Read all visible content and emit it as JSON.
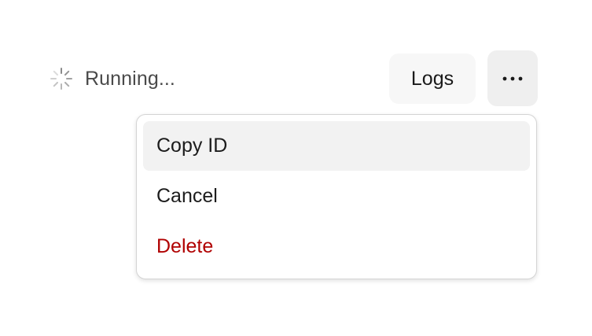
{
  "status": {
    "text": "Running...",
    "icon": "spinner-icon"
  },
  "actions": {
    "logs_label": "Logs",
    "more_icon": "ellipsis-icon"
  },
  "menu": {
    "items": [
      {
        "label": "Copy ID",
        "highlighted": true,
        "danger": false
      },
      {
        "label": "Cancel",
        "highlighted": false,
        "danger": false
      },
      {
        "label": "Delete",
        "highlighted": false,
        "danger": true
      }
    ]
  },
  "colors": {
    "danger": "#b00000",
    "highlight": "#f2f2f2",
    "button_bg": "#f7f7f7",
    "more_button_bg": "#efefef",
    "status_text": "#4a4a4a"
  }
}
